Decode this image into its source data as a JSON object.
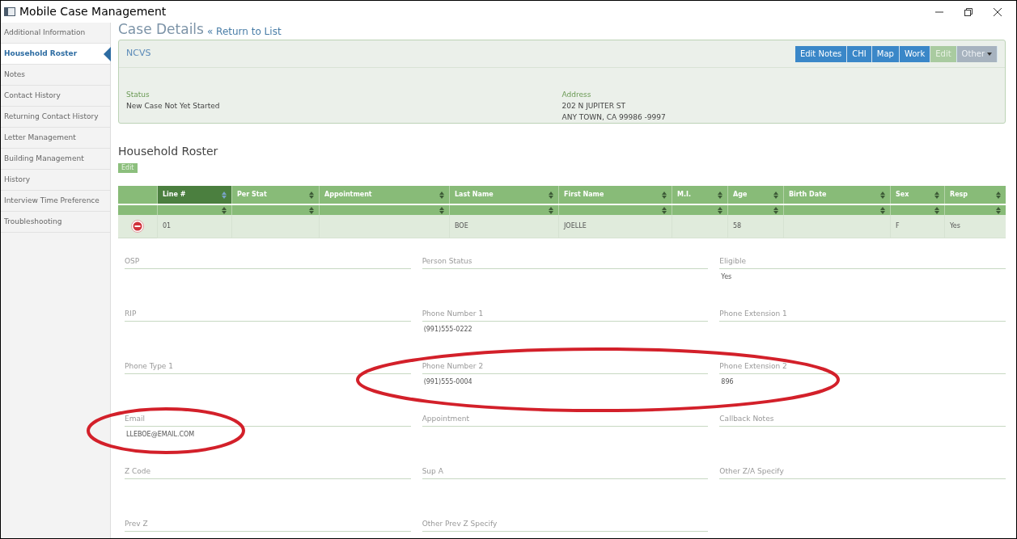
{
  "window": {
    "title": "Mobile Case Management"
  },
  "sidebar": {
    "items": [
      {
        "label": "Additional Information",
        "selected": false
      },
      {
        "label": "Household Roster",
        "selected": true
      },
      {
        "label": "Notes",
        "selected": false
      },
      {
        "label": "Contact History",
        "selected": false
      },
      {
        "label": "Returning Contact History",
        "selected": false
      },
      {
        "label": "Letter Management",
        "selected": false
      },
      {
        "label": "Building Management",
        "selected": false
      },
      {
        "label": "History",
        "selected": false
      },
      {
        "label": "Interview Time Preference",
        "selected": false
      },
      {
        "label": "Troubleshooting",
        "selected": false
      }
    ]
  },
  "header": {
    "title": "Case Details",
    "link": "« Return to List"
  },
  "case_panel": {
    "name": "NCVS",
    "buttons": [
      {
        "label": "Edit Notes",
        "kind": "primary"
      },
      {
        "label": "CHI",
        "kind": "primary"
      },
      {
        "label": "Map",
        "kind": "primary"
      },
      {
        "label": "Work",
        "kind": "primary"
      },
      {
        "label": "Edit",
        "kind": "disabled"
      },
      {
        "label": "Other",
        "kind": "dropdown"
      }
    ],
    "status": {
      "label": "Status",
      "value": "New Case Not Yet Started"
    },
    "address": {
      "label": "Address",
      "lines": [
        "202 N JUPITER ST",
        "ANY TOWN, CA 99986 -9997"
      ]
    }
  },
  "roster": {
    "title": "Household Roster",
    "edit_button": "Edit",
    "columns": [
      {
        "label": "Line #",
        "selected": true
      },
      {
        "label": "Per Stat",
        "selected": false
      },
      {
        "label": "Appointment",
        "selected": false
      },
      {
        "label": "Last Name",
        "selected": false
      },
      {
        "label": "First Name",
        "selected": false
      },
      {
        "label": "M.I.",
        "selected": false
      },
      {
        "label": "Age",
        "selected": false
      },
      {
        "label": "Birth Date",
        "selected": false
      },
      {
        "label": "Sex",
        "selected": false
      },
      {
        "label": "Resp",
        "selected": false
      }
    ],
    "rows": [
      {
        "cells": [
          "01",
          "",
          "",
          "BOE",
          "JOELLE",
          "",
          "58",
          "",
          "F",
          "Yes"
        ]
      }
    ]
  },
  "fields": [
    {
      "label": "OSP"
    },
    {
      "label": "Person Status"
    },
    {
      "label": "Eligible",
      "value": "Yes"
    },
    {
      "label": "RIP"
    },
    {
      "label": "Phone Number 1",
      "value": "(991)555-0222"
    },
    {
      "label": "Phone Extension 1"
    },
    {
      "label": "Phone Type 1"
    },
    {
      "label": "Phone Number 2",
      "value": "(991)555-0004"
    },
    {
      "label": "Phone Extension 2",
      "value": "896"
    },
    {
      "label": "Email",
      "value": "LLEBOE@EMAIL.COM"
    },
    {
      "label": "Appointment"
    },
    {
      "label": "Callback Notes"
    },
    {
      "label": "Z Code"
    },
    {
      "label": "Sup A"
    },
    {
      "label": "Other Z/A Specify"
    },
    {
      "label": "Prev Z"
    },
    {
      "label": "Other Prev Z Specify"
    }
  ]
}
